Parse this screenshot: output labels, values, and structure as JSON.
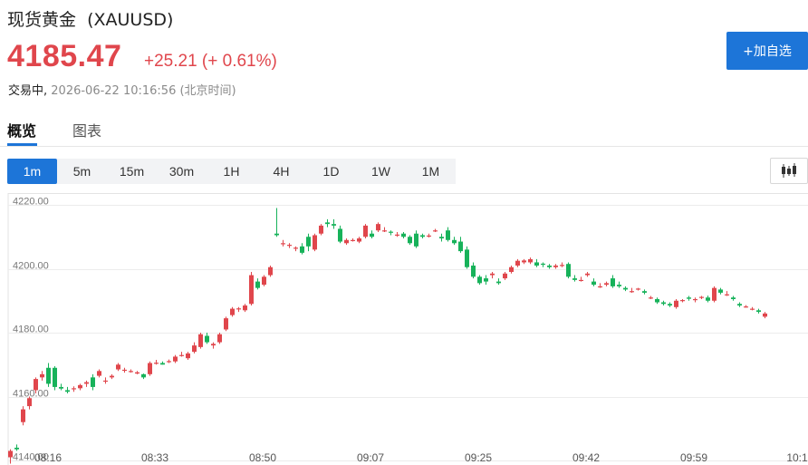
{
  "instrument": {
    "title": "现货黄金  (XAUUSD)",
    "price": "4185.47",
    "change": "+25.21 (+ 0.61%)",
    "status": "交易中,",
    "timestamp": "2026-06-22 10:16:56 (北京时间)"
  },
  "actions": {
    "add_watchlist": "+加自选"
  },
  "tabs": [
    {
      "label": "概览",
      "active": true
    },
    {
      "label": "图表",
      "active": false
    }
  ],
  "periods": [
    {
      "label": "1m",
      "active": true
    },
    {
      "label": "5m",
      "active": false
    },
    {
      "label": "15m",
      "active": false
    },
    {
      "label": "30m",
      "active": false
    },
    {
      "label": "1H",
      "active": false
    },
    {
      "label": "4H",
      "active": false
    },
    {
      "label": "1D",
      "active": false
    },
    {
      "label": "1W",
      "active": false
    },
    {
      "label": "1M",
      "active": false
    }
  ],
  "chart_type_icon": "candlestick-icon",
  "colors": {
    "up": "#e0464c",
    "down": "#17b25a",
    "accent": "#1d75d8"
  },
  "chart_data": {
    "type": "candlestick",
    "interval": "1m",
    "ylim": [
      4140,
      4220
    ],
    "ytick_labels": [
      "4220.00",
      "4200.00",
      "4180.00",
      "4160.00",
      "4140.00"
    ],
    "xtick_labels": [
      "08:16",
      "08:33",
      "08:50",
      "09:07",
      "09:25",
      "09:42",
      "09:59",
      "10:1"
    ],
    "ohlc": [
      [
        4141.0,
        4143.5,
        4139.0,
        4143.0
      ],
      [
        4144.0,
        4145.0,
        4143.0,
        4143.5
      ],
      [
        4152.0,
        4157.0,
        4151.0,
        4156.0
      ],
      [
        4157.0,
        4160.0,
        4156.0,
        4159.5
      ],
      [
        4162.0,
        4166.0,
        4161.0,
        4165.5
      ],
      [
        4166.0,
        4168.0,
        4165.0,
        4167.0
      ],
      [
        4169.0,
        4170.5,
        4163.0,
        4164.0
      ],
      [
        4169.0,
        4169.5,
        4162.0,
        4163.0
      ],
      [
        4163.0,
        4164.0,
        4162.0,
        4162.5
      ],
      [
        4162.0,
        4163.0,
        4161.0,
        4161.5
      ],
      [
        4162.5,
        4163.2,
        4161.5,
        4162.6
      ],
      [
        4162.6,
        4164.0,
        4162.0,
        4163.6
      ],
      [
        4164.0,
        4165.0,
        4163.0,
        4164.5
      ],
      [
        4166.0,
        4167.0,
        4162.0,
        4163.0
      ],
      [
        4166.5,
        4168.5,
        4166.0,
        4168.0
      ],
      [
        4165.0,
        4166.0,
        4164.0,
        4165.0
      ],
      [
        4166.0,
        4167.0,
        4165.5,
        4166.5
      ],
      [
        4168.5,
        4170.5,
        4168.0,
        4170.0
      ],
      [
        4168.4,
        4169.0,
        4167.5,
        4168.4
      ],
      [
        4168.0,
        4168.5,
        4167.5,
        4168.0
      ],
      [
        4167.2,
        4168.0,
        4167.0,
        4167.6
      ],
      [
        4167.0,
        4167.2,
        4165.5,
        4166.0
      ],
      [
        4167.0,
        4171.0,
        4166.5,
        4170.5
      ],
      [
        4170.6,
        4171.5,
        4170.0,
        4170.6
      ],
      [
        4170.5,
        4171.0,
        4170.0,
        4170.0
      ],
      [
        4171.0,
        4171.6,
        4170.5,
        4171.1
      ],
      [
        4171.0,
        4173.0,
        4170.5,
        4172.5
      ],
      [
        4173.0,
        4174.0,
        4172.5,
        4173.0
      ],
      [
        4172.0,
        4174.0,
        4171.5,
        4173.5
      ],
      [
        4174.0,
        4177.0,
        4173.5,
        4176.0
      ],
      [
        4175.5,
        4180.0,
        4175.0,
        4179.5
      ],
      [
        4179.0,
        4180.0,
        4176.5,
        4177.0
      ],
      [
        4176.0,
        4177.0,
        4175.0,
        4176.5
      ],
      [
        4177.0,
        4180.0,
        4176.5,
        4179.5
      ],
      [
        4181.0,
        4185.0,
        4180.5,
        4184.5
      ],
      [
        4185.5,
        4188.0,
        4185.0,
        4187.5
      ],
      [
        4187.6,
        4188.0,
        4186.5,
        4187.6
      ],
      [
        4187.0,
        4189.0,
        4186.5,
        4188.5
      ],
      [
        4189.0,
        4199.0,
        4188.5,
        4198.0
      ],
      [
        4196.0,
        4197.0,
        4193.5,
        4194.0
      ],
      [
        4195.0,
        4198.0,
        4194.5,
        4197.5
      ],
      [
        4198.0,
        4201.0,
        4197.5,
        4200.5
      ],
      [
        4211.0,
        4219.0,
        4210.0,
        4210.5
      ],
      [
        4208.0,
        4209.0,
        4207.0,
        4208.0
      ],
      [
        4207.5,
        4208.0,
        4206.5,
        4207.5
      ],
      [
        4206.6,
        4207.0,
        4205.5,
        4206.6
      ],
      [
        4207.0,
        4208.0,
        4204.5,
        4205.0
      ],
      [
        4210.0,
        4211.0,
        4205.5,
        4207.0
      ],
      [
        4206.0,
        4211.0,
        4205.5,
        4210.5
      ],
      [
        4211.0,
        4214.0,
        4210.5,
        4213.5
      ],
      [
        4214.5,
        4215.5,
        4213.0,
        4214.0
      ],
      [
        4214.0,
        4215.5,
        4212.5,
        4213.5
      ],
      [
        4212.5,
        4213.5,
        4208.0,
        4208.5
      ],
      [
        4208.0,
        4209.5,
        4207.5,
        4209.0
      ],
      [
        4209.0,
        4209.5,
        4208.5,
        4209.0
      ],
      [
        4208.5,
        4210.0,
        4208.0,
        4209.5
      ],
      [
        4210.0,
        4214.0,
        4209.5,
        4213.5
      ],
      [
        4211.0,
        4212.0,
        4209.5,
        4210.0
      ],
      [
        4212.0,
        4214.5,
        4211.5,
        4214.0
      ],
      [
        4212.0,
        4213.0,
        4211.5,
        4212.0
      ],
      [
        4211.6,
        4212.0,
        4210.5,
        4211.4
      ],
      [
        4210.7,
        4211.5,
        4210.0,
        4210.7
      ],
      [
        4211.0,
        4211.5,
        4209.5,
        4210.0
      ],
      [
        4210.0,
        4210.5,
        4207.5,
        4208.0
      ],
      [
        4211.0,
        4212.0,
        4206.5,
        4207.0
      ],
      [
        4210.5,
        4211.0,
        4209.5,
        4210.0
      ],
      [
        4210.4,
        4211.0,
        4209.8,
        4210.4
      ],
      [
        4212.0,
        4212.5,
        4211.5,
        4212.0
      ],
      [
        4210.0,
        4211.0,
        4208.5,
        4209.5
      ],
      [
        4212.0,
        4213.0,
        4208.5,
        4209.0
      ],
      [
        4209.0,
        4210.0,
        4207.5,
        4208.0
      ],
      [
        4208.5,
        4210.0,
        4205.0,
        4205.5
      ],
      [
        4206.0,
        4207.0,
        4200.0,
        4200.5
      ],
      [
        4201.0,
        4202.0,
        4197.0,
        4197.5
      ],
      [
        4197.5,
        4198.0,
        4195.0,
        4195.5
      ],
      [
        4197.0,
        4198.0,
        4195.0,
        4196.0
      ],
      [
        4198.0,
        4199.0,
        4197.0,
        4198.5
      ],
      [
        4196.0,
        4197.0,
        4195.0,
        4195.5
      ],
      [
        4197.0,
        4199.0,
        4196.5,
        4198.5
      ],
      [
        4199.0,
        4201.0,
        4198.5,
        4200.5
      ],
      [
        4201.0,
        4203.0,
        4200.5,
        4202.5
      ],
      [
        4202.0,
        4203.0,
        4201.5,
        4202.6
      ],
      [
        4202.0,
        4203.5,
        4201.5,
        4203.0
      ],
      [
        4202.0,
        4203.0,
        4200.5,
        4201.0
      ],
      [
        4201.6,
        4202.0,
        4200.5,
        4201.4
      ],
      [
        4201.0,
        4201.5,
        4200.0,
        4200.5
      ],
      [
        4200.5,
        4201.5,
        4200.0,
        4201.0
      ],
      [
        4201.0,
        4202.0,
        4200.5,
        4201.2
      ],
      [
        4201.5,
        4202.0,
        4197.0,
        4197.5
      ],
      [
        4197.0,
        4198.0,
        4196.0,
        4196.5
      ],
      [
        4196.5,
        4197.5,
        4196.0,
        4196.5
      ],
      [
        4198.0,
        4199.0,
        4197.5,
        4198.5
      ],
      [
        4196.0,
        4197.0,
        4194.5,
        4195.0
      ],
      [
        4194.5,
        4195.5,
        4194.0,
        4194.5
      ],
      [
        4195.0,
        4196.0,
        4194.5,
        4195.5
      ],
      [
        4197.0,
        4198.0,
        4194.0,
        4194.5
      ],
      [
        4195.0,
        4196.0,
        4194.0,
        4194.5
      ],
      [
        4194.0,
        4194.5,
        4193.0,
        4193.5
      ],
      [
        4193.0,
        4194.0,
        4192.5,
        4193.0
      ],
      [
        4193.8,
        4194.0,
        4193.2,
        4193.8
      ],
      [
        4193.0,
        4193.5,
        4192.0,
        4192.5
      ],
      [
        4191.0,
        4191.5,
        4190.5,
        4191.0
      ],
      [
        4190.5,
        4191.0,
        4189.0,
        4189.5
      ],
      [
        4189.5,
        4190.0,
        4188.5,
        4189.0
      ],
      [
        4189.0,
        4189.5,
        4188.0,
        4188.5
      ],
      [
        4188.0,
        4190.5,
        4187.5,
        4190.0
      ],
      [
        4190.0,
        4190.5,
        4189.5,
        4190.2
      ],
      [
        4191.0,
        4191.5,
        4190.0,
        4190.6
      ],
      [
        4190.5,
        4191.0,
        4189.5,
        4190.5
      ],
      [
        4191.0,
        4191.5,
        4190.5,
        4191.2
      ],
      [
        4191.0,
        4191.6,
        4189.5,
        4190.0
      ],
      [
        4190.0,
        4194.5,
        4189.5,
        4194.0
      ],
      [
        4193.5,
        4194.0,
        4192.0,
        4192.5
      ],
      [
        4192.0,
        4193.0,
        4191.5,
        4192.0
      ],
      [
        4191.0,
        4191.5,
        4190.0,
        4190.5
      ],
      [
        4189.0,
        4189.5,
        4188.0,
        4188.5
      ],
      [
        4188.2,
        4188.6,
        4187.8,
        4188.2
      ],
      [
        4187.5,
        4188.0,
        4187.0,
        4187.5
      ],
      [
        4187.0,
        4187.5,
        4186.0,
        4186.5
      ],
      [
        4185.0,
        4186.5,
        4184.5,
        4186.0
      ]
    ]
  }
}
